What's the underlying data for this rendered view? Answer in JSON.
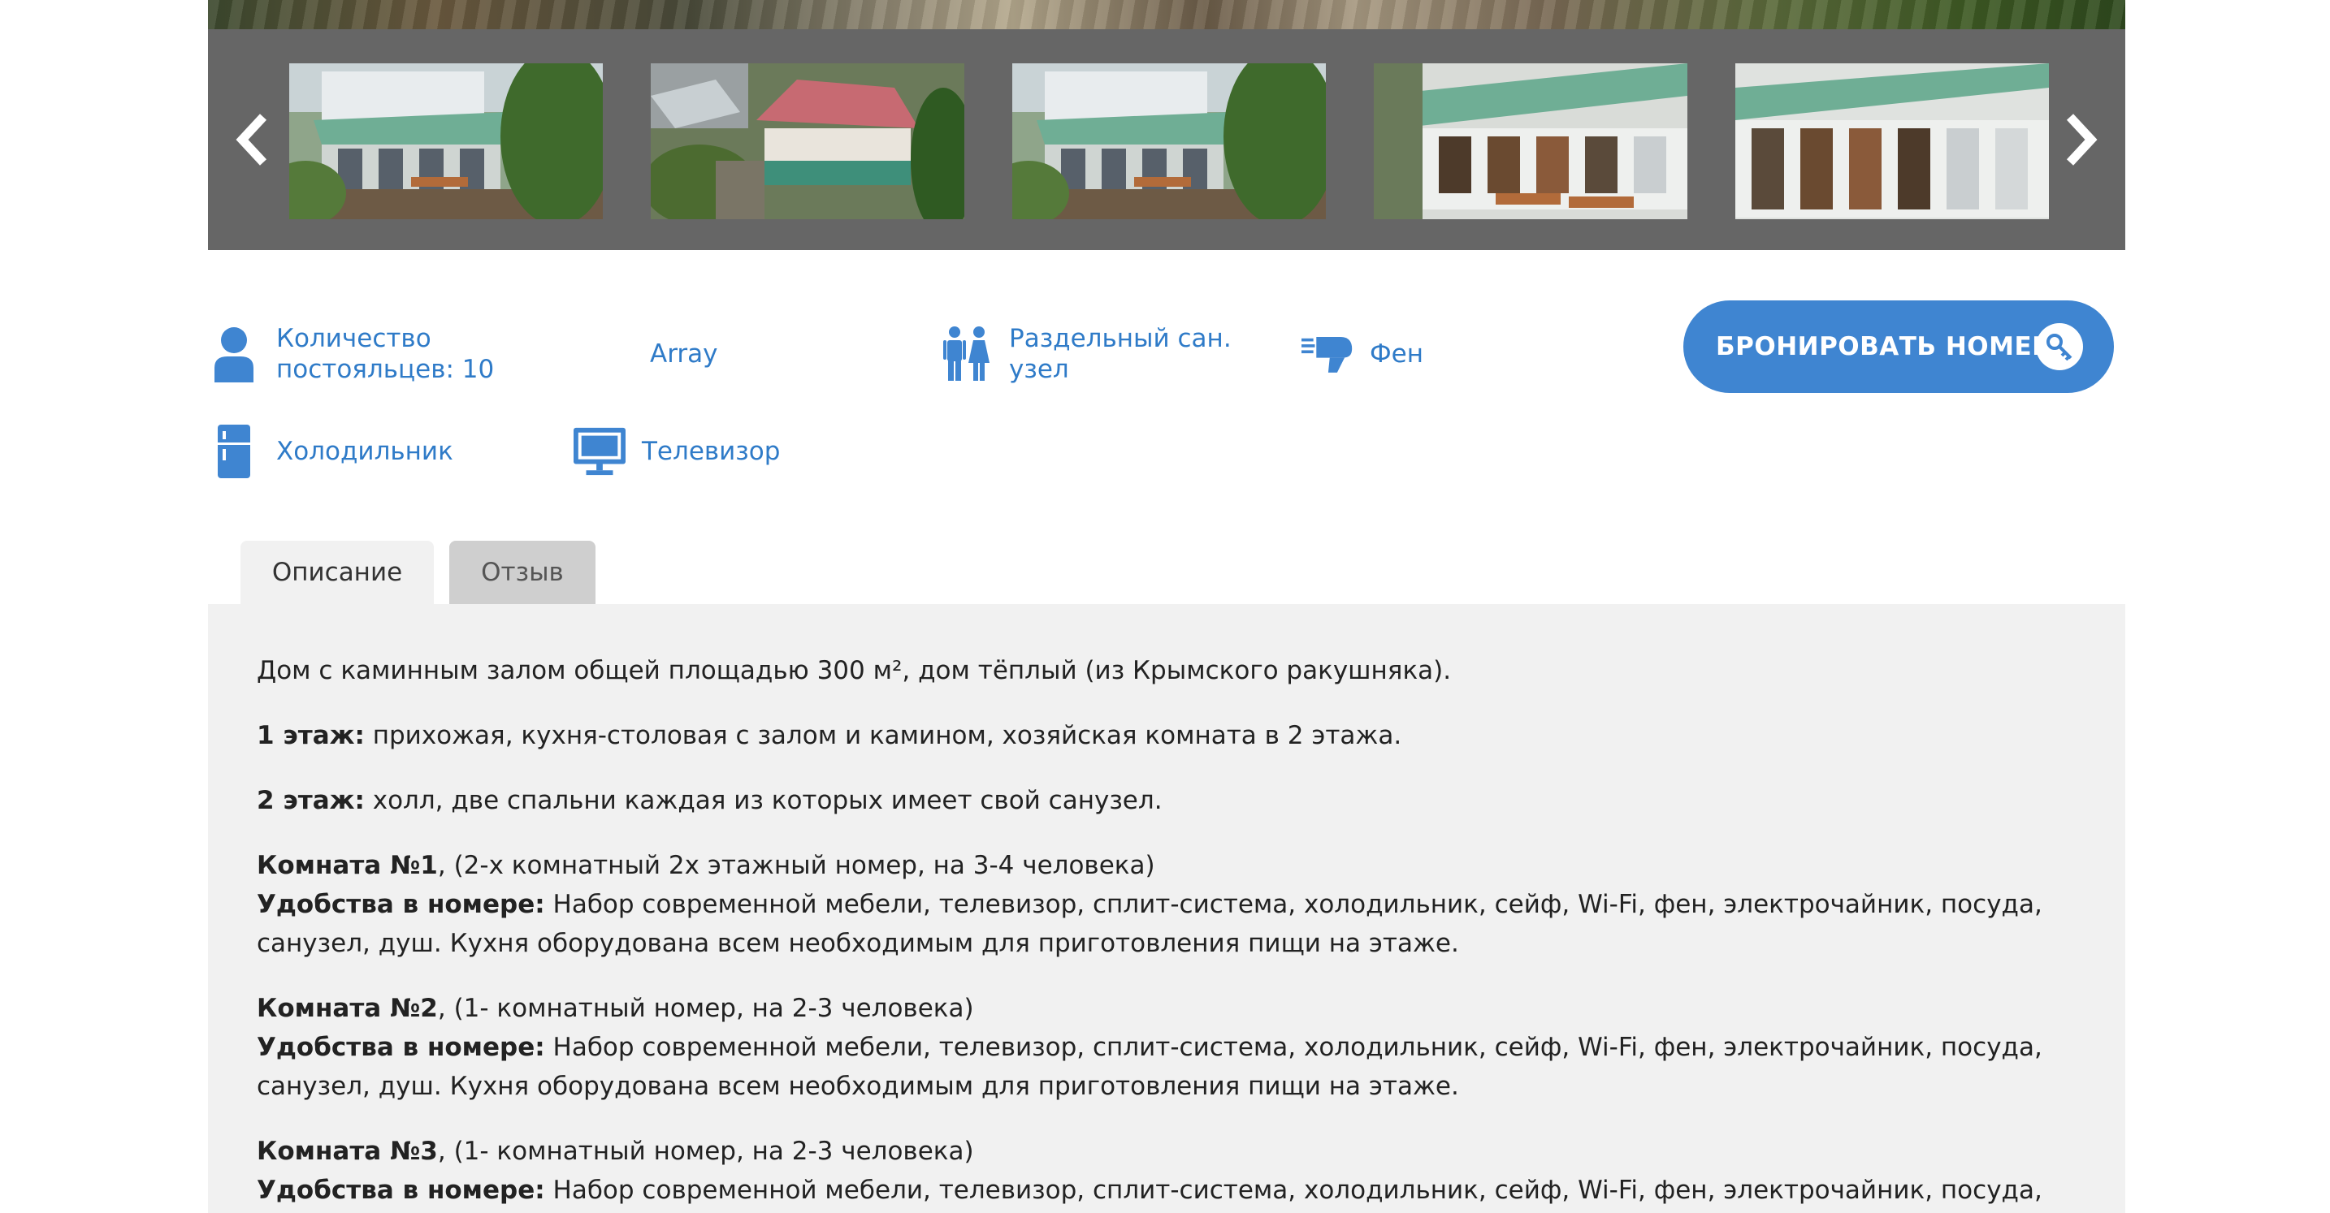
{
  "carousel": {
    "thumbnails": [
      {
        "alt": "house-veranda-photo-1"
      },
      {
        "alt": "house-aerial-photo"
      },
      {
        "alt": "house-veranda-photo-2"
      },
      {
        "alt": "veranda-benches-photo"
      },
      {
        "alt": "veranda-interior-photo"
      }
    ]
  },
  "amenities": {
    "guests": "Количество постояльцев: 10",
    "array": "Array",
    "bathroom": "Раздельный сан. узел",
    "hairdryer": "Фен",
    "fridge": "Холодильник",
    "tv": "Телевизор"
  },
  "book_button": {
    "label": "БРОНИРОВАТЬ НОМЕР"
  },
  "tabs": {
    "description": "Описание",
    "review": "Отзыв"
  },
  "description": {
    "intro": "Дом с каминным залом общей площадью 300 м², дом тёплый (из Крымского ракушняка).",
    "floor1_label": "1 этаж:",
    "floor1_text": " прихожая, кухня-столовая с залом и камином, хозяйская комната в 2 этажа.",
    "floor2_label": "2 этаж:",
    "floor2_text": " холл, две спальни каждая из которых имеет свой санузел.",
    "room1_label": "Комната №1",
    "room1_text": ", (2-х комнатный 2х этажный номер, на 3-4 человека)",
    "amen_label": "Удобства в номере:",
    "amen_text": " Набор современной мебели, телевизор, сплит-система, холодильник, сейф, Wi-Fi, фен, электрочайник, посуда, санузел, душ. Кухня оборудована всем необходимым для приготовления пищи на этаже.",
    "room2_label": "Комната №2",
    "room2_text": ", (1- комнатный номер, на 2-3 человека)",
    "room3_label": "Комната №3",
    "room3_text": ", (1- комнатный номер, на 2-3 человека)",
    "amen3_text": " Набор современной мебели, телевизор, сплит-система, холодильник, сейф, Wi-Fi, фен, электрочайник, посуда, санузел,"
  },
  "colors": {
    "accent": "#3f85d1",
    "link": "#2f7bc8",
    "carousel_bg": "#666666",
    "content_bg": "#f1f1f1"
  }
}
